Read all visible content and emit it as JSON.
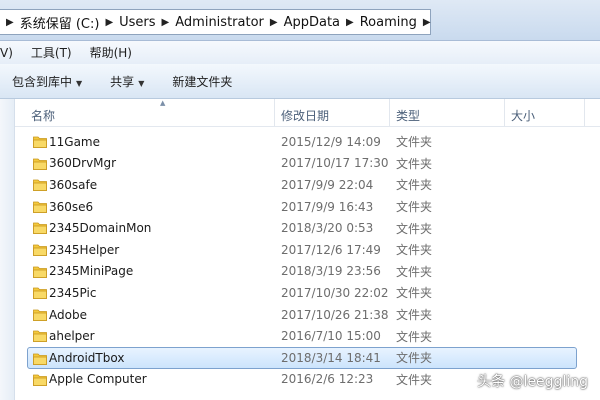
{
  "address": {
    "crumbs": [
      "系统保留 (C:)",
      "Users",
      "Administrator",
      "AppData",
      "Roaming"
    ]
  },
  "menu": {
    "items": [
      "V)",
      "工具(T)",
      "帮助(H)"
    ]
  },
  "toolbar": {
    "include_label": "包含到库中",
    "share_label": "共享",
    "new_folder_label": "新建文件夹"
  },
  "columns": {
    "name": "名称",
    "date": "修改日期",
    "type": "类型",
    "size": "大小"
  },
  "rows": [
    {
      "name": "11Game",
      "date": "2015/12/9 14:09",
      "type": "文件夹"
    },
    {
      "name": "360DrvMgr",
      "date": "2017/10/17 17:30",
      "type": "文件夹"
    },
    {
      "name": "360safe",
      "date": "2017/9/9 22:04",
      "type": "文件夹"
    },
    {
      "name": "360se6",
      "date": "2017/9/9 16:43",
      "type": "文件夹"
    },
    {
      "name": "2345DomainMon",
      "date": "2018/3/20 0:53",
      "type": "文件夹"
    },
    {
      "name": "2345Helper",
      "date": "2017/12/6 17:49",
      "type": "文件夹"
    },
    {
      "name": "2345MiniPage",
      "date": "2018/3/19 23:56",
      "type": "文件夹"
    },
    {
      "name": "2345Pic",
      "date": "2017/10/30 22:02",
      "type": "文件夹"
    },
    {
      "name": "Adobe",
      "date": "2017/10/26 21:38",
      "type": "文件夹"
    },
    {
      "name": "ahelper",
      "date": "2016/7/10 15:00",
      "type": "文件夹"
    },
    {
      "name": "AndroidTbox",
      "date": "2018/3/14 18:41",
      "type": "文件夹"
    },
    {
      "name": "Apple Computer",
      "date": "2016/2/6 12:23",
      "type": "文件夹"
    }
  ],
  "selected_index": 10,
  "watermark": "头条 @leeggling",
  "colors": {
    "folder": "#f3c93d",
    "selection_border": "#7da2ce",
    "header_text": "#4c607a"
  }
}
